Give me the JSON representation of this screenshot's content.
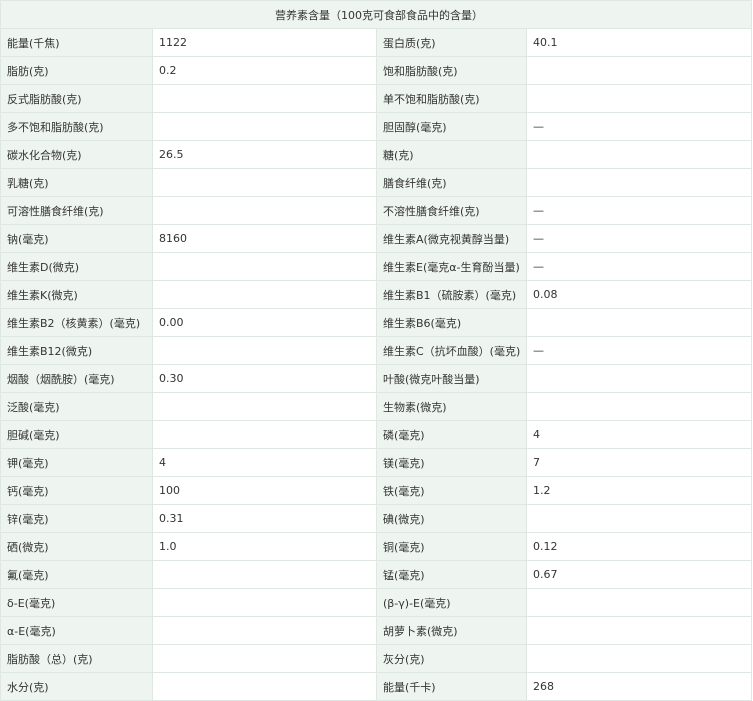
{
  "table": {
    "title": "营养素含量（100克可食部食品中的含量）",
    "rows": [
      [
        {
          "label": "能量(千焦)",
          "value": "1122"
        },
        {
          "label": "蛋白质(克)",
          "value": "40.1"
        }
      ],
      [
        {
          "label": "脂肪(克)",
          "value": "0.2"
        },
        {
          "label": "饱和脂肪酸(克)",
          "value": ""
        }
      ],
      [
        {
          "label": "反式脂肪酸(克)",
          "value": ""
        },
        {
          "label": "单不饱和脂肪酸(克)",
          "value": ""
        }
      ],
      [
        {
          "label": "多不饱和脂肪酸(克)",
          "value": ""
        },
        {
          "label": "胆固醇(毫克)",
          "value": "—"
        }
      ],
      [
        {
          "label": "碳水化合物(克)",
          "value": "26.5"
        },
        {
          "label": "糖(克)",
          "value": ""
        }
      ],
      [
        {
          "label": "乳糖(克)",
          "value": ""
        },
        {
          "label": "膳食纤维(克)",
          "value": ""
        }
      ],
      [
        {
          "label": "可溶性膳食纤维(克)",
          "value": ""
        },
        {
          "label": "不溶性膳食纤维(克)",
          "value": "—"
        }
      ],
      [
        {
          "label": "钠(毫克)",
          "value": "8160"
        },
        {
          "label": "维生素A(微克视黄醇当量)",
          "value": "—"
        }
      ],
      [
        {
          "label": "维生素D(微克)",
          "value": ""
        },
        {
          "label": "维生素E(毫克α-生育酚当量)",
          "value": "—"
        }
      ],
      [
        {
          "label": "维生素K(微克)",
          "value": ""
        },
        {
          "label": "维生素B1（硫胺素）(毫克)",
          "value": "0.08"
        }
      ],
      [
        {
          "label": "维生素B2（核黄素）(毫克)",
          "value": "0.00"
        },
        {
          "label": "维生素B6(毫克)",
          "value": ""
        }
      ],
      [
        {
          "label": "维生素B12(微克)",
          "value": ""
        },
        {
          "label": "维生素C（抗坏血酸）(毫克)",
          "value": "—"
        }
      ],
      [
        {
          "label": "烟酸（烟酰胺）(毫克)",
          "value": "0.30"
        },
        {
          "label": "叶酸(微克叶酸当量)",
          "value": ""
        }
      ],
      [
        {
          "label": "泛酸(毫克)",
          "value": ""
        },
        {
          "label": "生物素(微克)",
          "value": ""
        }
      ],
      [
        {
          "label": "胆碱(毫克)",
          "value": ""
        },
        {
          "label": "磷(毫克)",
          "value": "4"
        }
      ],
      [
        {
          "label": "钾(毫克)",
          "value": "4"
        },
        {
          "label": "镁(毫克)",
          "value": "7"
        }
      ],
      [
        {
          "label": "钙(毫克)",
          "value": "100"
        },
        {
          "label": "铁(毫克)",
          "value": "1.2"
        }
      ],
      [
        {
          "label": "锌(毫克)",
          "value": "0.31"
        },
        {
          "label": "碘(微克)",
          "value": ""
        }
      ],
      [
        {
          "label": "硒(微克)",
          "value": "1.0"
        },
        {
          "label": "铜(毫克)",
          "value": "0.12"
        }
      ],
      [
        {
          "label": "氟(毫克)",
          "value": ""
        },
        {
          "label": "锰(毫克)",
          "value": "0.67"
        }
      ],
      [
        {
          "label": "δ-E(毫克)",
          "value": ""
        },
        {
          "label": "(β-γ)-E(毫克)",
          "value": ""
        }
      ],
      [
        {
          "label": "α-E(毫克)",
          "value": ""
        },
        {
          "label": "胡萝卜素(微克)",
          "value": ""
        }
      ],
      [
        {
          "label": "脂肪酸（总）(克)",
          "value": ""
        },
        {
          "label": "灰分(克)",
          "value": ""
        }
      ],
      [
        {
          "label": "水分(克)",
          "value": ""
        },
        {
          "label": "能量(千卡)",
          "value": "268"
        }
      ]
    ]
  }
}
